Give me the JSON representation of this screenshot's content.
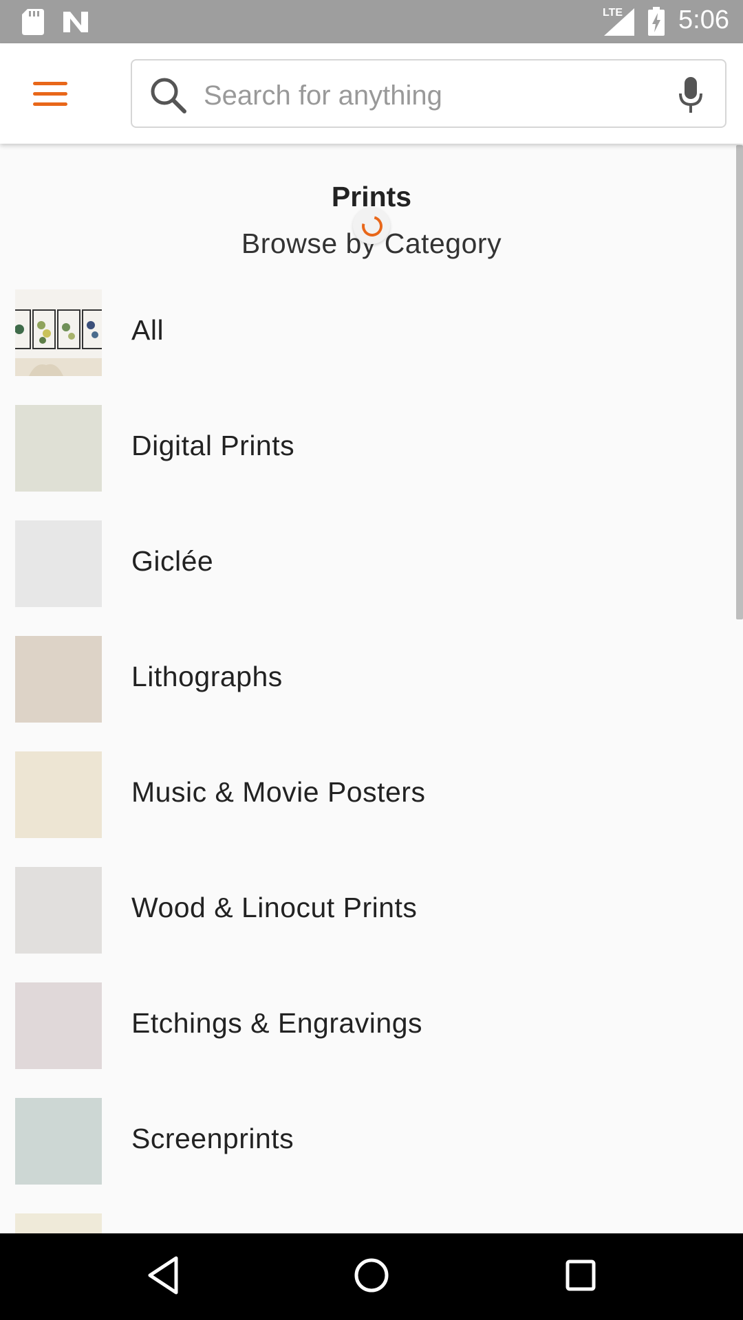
{
  "status_bar": {
    "time": "5:06",
    "network_label": "LTE",
    "icons": [
      "sd-card-icon",
      "n-notification-icon",
      "signal-icon",
      "battery-charging-icon"
    ]
  },
  "app_bar": {
    "menu_icon": "hamburger-menu-icon",
    "search": {
      "placeholder": "Search for anything",
      "value": "",
      "icon": "search-icon",
      "voice_icon": "microphone-icon"
    }
  },
  "page": {
    "title": "Prints",
    "subtitle": "Browse by Category",
    "loading": true
  },
  "categories": [
    {
      "label": "All",
      "thumb_color": "#e8e2d6"
    },
    {
      "label": "Digital Prints",
      "thumb_color": "#dfe0d5"
    },
    {
      "label": "Giclée",
      "thumb_color": "#e7e7e7"
    },
    {
      "label": "Lithographs",
      "thumb_color": "#ddd3c7"
    },
    {
      "label": "Music & Movie Posters",
      "thumb_color": "#ede5d3"
    },
    {
      "label": "Wood & Linocut Prints",
      "thumb_color": "#e1dfdd"
    },
    {
      "label": "Etchings & Engravings",
      "thumb_color": "#e0d8d9"
    },
    {
      "label": "Screenprints",
      "thumb_color": "#cdd7d4"
    },
    {
      "label": "",
      "thumb_color": "#efead9"
    }
  ],
  "nav_bar": {
    "back_icon": "back-triangle-icon",
    "home_icon": "home-circle-icon",
    "recents_icon": "recents-square-icon"
  },
  "colors": {
    "accent": "#e8671a",
    "status_bar": "#9e9e9e",
    "nav_bar": "#000000"
  }
}
